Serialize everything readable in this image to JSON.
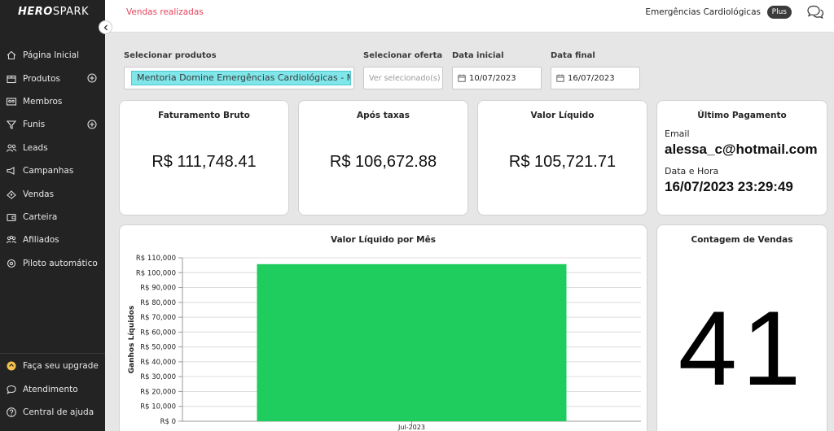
{
  "sidebar": {
    "logo_bold": "HERO",
    "logo_rest": "SPARK",
    "items": [
      {
        "label": "Página Inicial",
        "icon": "home-icon",
        "plus": false
      },
      {
        "label": "Produtos",
        "icon": "box-icon",
        "plus": true
      },
      {
        "label": "Membros",
        "icon": "members-icon",
        "plus": false
      },
      {
        "label": "Funis",
        "icon": "funnel-icon",
        "plus": true
      },
      {
        "label": "Leads",
        "icon": "leads-icon",
        "plus": false
      },
      {
        "label": "Campanhas",
        "icon": "campaign-icon",
        "plus": false
      },
      {
        "label": "Vendas",
        "icon": "sales-icon",
        "plus": false
      },
      {
        "label": "Carteira",
        "icon": "wallet-icon",
        "plus": false
      },
      {
        "label": "Afiliados",
        "icon": "affiliates-icon",
        "plus": false
      },
      {
        "label": "Piloto automático",
        "icon": "autopilot-icon",
        "plus": false
      }
    ],
    "bottom": [
      {
        "label": "Faça seu upgrade",
        "icon": "upgrade-icon"
      },
      {
        "label": "Atendimento",
        "icon": "chat-bubble-icon"
      },
      {
        "label": "Central de ajuda",
        "icon": "help-icon"
      }
    ]
  },
  "topbar": {
    "breadcrumb": "Vendas realizadas",
    "account": "Emergências Cardiológicas",
    "plan_badge": "Plus"
  },
  "filters": {
    "products_label": "Selecionar produtos",
    "product_chip": "Mentoria Domine Emergências Cardiológicas - Método",
    "offer_label": "Selecionar oferta",
    "offer_placeholder": "Ver selecionado(s)",
    "start_label": "Data inicial",
    "start_value": "10/07/2023",
    "end_label": "Data final",
    "end_value": "16/07/2023"
  },
  "cards": {
    "gross": {
      "title": "Faturamento Bruto",
      "value": "R$ 111,748.41"
    },
    "after_fees": {
      "title": "Após taxas",
      "value": "R$ 106,672.88"
    },
    "net": {
      "title": "Valor Líquido",
      "value": "R$ 105,721.71"
    },
    "last_payment": {
      "title": "Último Pagamento",
      "email_label": "Email",
      "email": "alessa_c@hotmail.com",
      "datetime_label": "Data e Hora",
      "datetime": "16/07/2023 23:29:49"
    },
    "sales_count": {
      "title": "Contagem de Vendas",
      "value": "41"
    }
  },
  "chart_title": "Valor Líquido por Mês",
  "chart_data": {
    "type": "bar",
    "title": "Valor Líquido por Mês",
    "xlabel": "",
    "ylabel": "Ganhos Líquidos",
    "categories": [
      "Jul-2023"
    ],
    "values": [
      105721.71
    ],
    "ylim": [
      0,
      110000
    ],
    "yticks": [
      "R$ 0",
      "R$ 10,000",
      "R$ 20,000",
      "R$ 30,000",
      "R$ 40,000",
      "R$ 50,000",
      "R$ 60,000",
      "R$ 70,000",
      "R$ 80,000",
      "R$ 90,000",
      "R$ 100,000",
      "R$ 110,000"
    ],
    "grid": true,
    "bar_color": "#1fcc5e"
  }
}
